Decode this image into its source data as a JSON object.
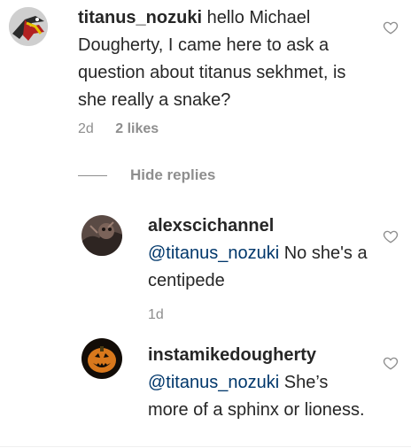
{
  "colors": {
    "text": "#262626",
    "muted": "#8e8e8e",
    "mention": "#00376b"
  },
  "comment": {
    "username": "titanus_nozuki",
    "text": " hello Michael Dougherty, I came here to ask a question about titanus sekhmet, is she really a snake?",
    "age": "2d",
    "likes": "2 likes",
    "avatar_icon": "hawk-drawing-avatar",
    "like_icon": "heart-outline-icon"
  },
  "hide_replies_label": "Hide replies",
  "replies": [
    {
      "username": "alexscichannel",
      "mention": "@titanus_nozuki",
      "text": " No she's a centipede",
      "age": "1d",
      "avatar_icon": "creature-photo-avatar",
      "like_icon": "heart-outline-icon"
    },
    {
      "username": "instamikedougherty",
      "mention": "@titanus_nozuki",
      "text": " She’s more of a sphinx or lioness.",
      "avatar_icon": "jack-o-lantern-avatar",
      "like_icon": "heart-outline-icon"
    }
  ]
}
